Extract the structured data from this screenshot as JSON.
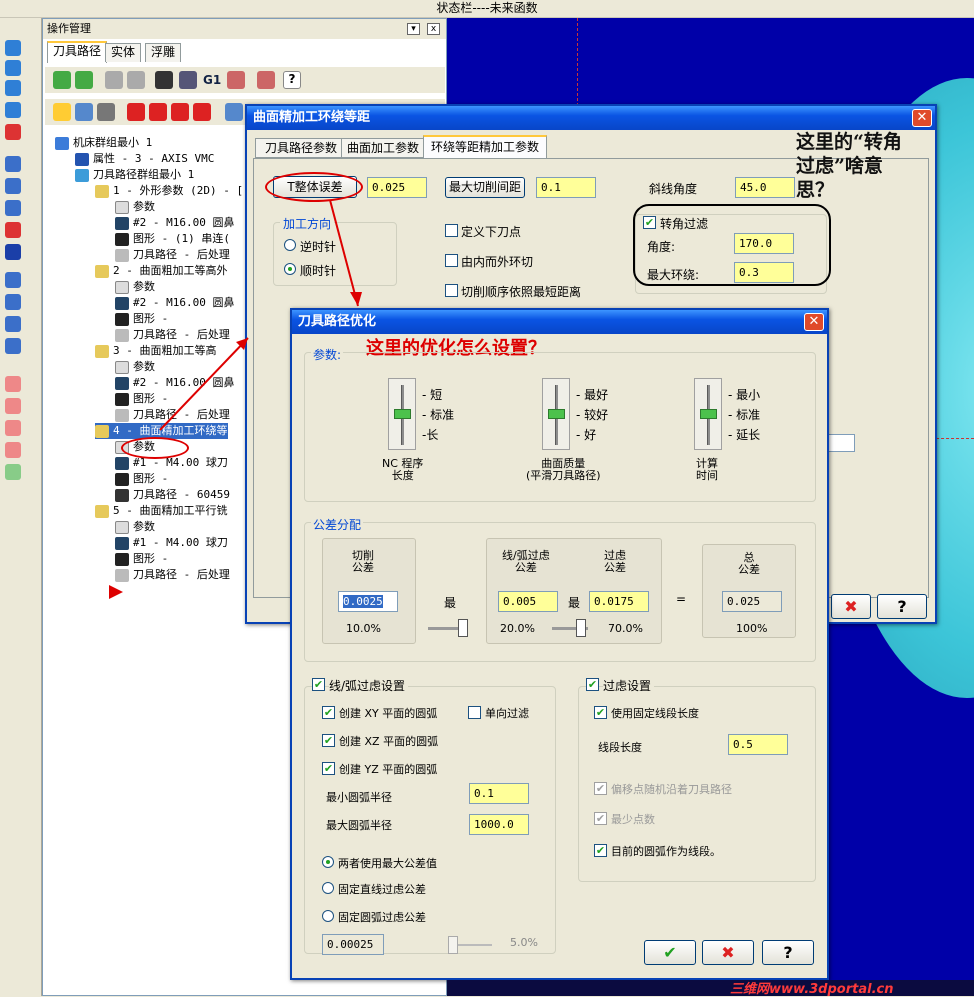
{
  "statusbar": {
    "text": "状态栏----未来函数"
  },
  "ops_manager": {
    "title": "操作管理",
    "tabs": [
      "刀具路径",
      "实体",
      "浮雕"
    ],
    "tree": [
      {
        "label": "机床群组最小 1"
      },
      {
        "label": "属性 - 3 - AXIS VMC"
      },
      {
        "label": "刀具路径群组最小 1"
      },
      {
        "label": "1 - 外形参数 (2D) - ["
      },
      {
        "label": "参数"
      },
      {
        "label": "#2 - M16.00 圆鼻"
      },
      {
        "label": "图形 - (1) 串连("
      },
      {
        "label": "刀具路径 - 后处理"
      },
      {
        "label": "2 - 曲面粗加工等高外"
      },
      {
        "label": "参数"
      },
      {
        "label": "#2 - M16.00 圆鼻"
      },
      {
        "label": "图形 -"
      },
      {
        "label": "刀具路径 - 后处理"
      },
      {
        "label": "3 - 曲面粗加工等高"
      },
      {
        "label": "参数"
      },
      {
        "label": "#2 - M16.00 圆鼻"
      },
      {
        "label": "图形 -"
      },
      {
        "label": "刀具路径 - 后处理"
      },
      {
        "label": "4 - 曲面精加工环绕等"
      },
      {
        "label": "参数"
      },
      {
        "label": "#1 - M4.00 球刀"
      },
      {
        "label": "图形 -"
      },
      {
        "label": "刀具路径 - 60459"
      },
      {
        "label": "5 - 曲面精加工平行铣"
      },
      {
        "label": "参数"
      },
      {
        "label": "#1 - M4.00 球刀"
      },
      {
        "label": "图形 -"
      },
      {
        "label": "刀具路径 - 后处理"
      }
    ]
  },
  "dialog_scallop": {
    "title": "曲面精加工环绕等距",
    "tabs": [
      "刀具路径参数",
      "曲面加工参数",
      "环绕等距精加工参数"
    ],
    "tolerance_label": "T整体误差",
    "tolerance_value": "0.025",
    "max_stepover_label": "最大切削间距",
    "max_stepover_value": "0.1",
    "angle_label": "斜线角度",
    "angle_value": "45.0",
    "direction_group": "加工方向",
    "dir_ccw": "逆时针",
    "dir_cw": "顺时针",
    "define_start": "定义下刀点",
    "inside_out": "由内而外环切",
    "cut_order": "切削顺序依照最短距离",
    "corner_filter_label": "转角过滤",
    "corner_angle_label": "角度:",
    "corner_angle_value": "170.0",
    "max_loop_label": "最大环绕:",
    "max_loop_value": "0.3",
    "btn_cancel": "✖",
    "btn_help": "?"
  },
  "annotations": {
    "note1": "这里的“转角过虑”啥意思？",
    "note2": "这里的优化怎么设置？"
  },
  "dialog_optimize": {
    "title": "刀具路径优化",
    "params_group": "参数:",
    "slider1": {
      "labels": [
        "短",
        "标准",
        "长"
      ],
      "caption": "NC 程序\n长度"
    },
    "slider2": {
      "labels": [
        "最好",
        "较好",
        "好"
      ],
      "caption": "曲面质量\n(平滑刀具路径)"
    },
    "slider3": {
      "labels": [
        "最小",
        "标准",
        "延长"
      ],
      "caption": "计算\n时间"
    },
    "tol_group": "公差分配",
    "cut_tol_label": "切削\n公差",
    "cut_tol_value": "0.0025",
    "cut_tol_pct": "10.0%",
    "max_label": "最",
    "line_arc_tol_label": "线/弧过虑\n公差",
    "line_arc_tol_value": "0.005",
    "line_arc_pct": "20.0%",
    "max_label2": "最",
    "filter_tol_label": "过虑\n公差",
    "filter_tol_value": "0.0175",
    "filter_pct": "70.0%",
    "equals": "=",
    "total_tol_label": "总\n公差",
    "total_tol_value": "0.025",
    "total_pct": "100%",
    "line_arc_group": "线/弧过虑设置",
    "create_xy": "创建 XY 平面的圆弧",
    "one_way": "单向过滤",
    "create_xz": "创建 XZ 平面的圆弧",
    "create_yz": "创建 YZ 平面的圆弧",
    "min_radius_label": "最小圆弧半径",
    "min_radius_value": "0.1",
    "max_radius_label": "最大圆弧半径",
    "max_radius_value": "1000.0",
    "opt_both": "两者使用最大公差值",
    "opt_line": "固定直线过虑公差",
    "opt_arc": "固定圆弧过虑公差",
    "arc_tol_value": "0.00025",
    "arc_tol_pct": "5.0%",
    "filter_group": "过虑设置",
    "fixed_seg": "使用固定线段长度",
    "seg_len_label": "线段长度",
    "seg_len_value": "0.5",
    "offset_random": "偏移点随机沿着刀具路径",
    "min_points": "最少点数",
    "current_arc": "目前的圆弧作为线段。",
    "btn_ok": "✔",
    "btn_cancel": "✖",
    "btn_help": "?"
  },
  "watermark": "三维网www.3dportal.cn"
}
